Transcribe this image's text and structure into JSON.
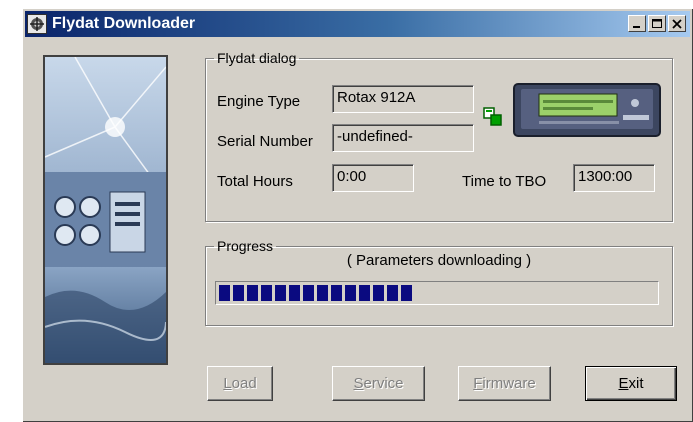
{
  "window": {
    "title": "Flydat Downloader",
    "icon": "flydat-app-icon",
    "controls": [
      "minimize-icon",
      "maximize-icon",
      "close-icon"
    ]
  },
  "side_image": {
    "description_icon": "cockpit-instruments-image"
  },
  "dialog": {
    "legend": "Flydat dialog",
    "engine_type_label": "Engine Type",
    "engine_type_value": "Rotax 912A",
    "serial_number_label": "Serial Number",
    "serial_number_value": "-undefined-",
    "total_hours_label": "Total Hours",
    "total_hours_value": "0:00",
    "time_to_tbo_label": "Time to TBO",
    "time_to_tbo_value": "1300:00",
    "link_icon": "connection-link-icon",
    "device_icon": "flydat-device-icon"
  },
  "progress": {
    "legend": "Progress",
    "status": "( Parameters downloading )",
    "fraction": 0.45
  },
  "buttons": {
    "load": {
      "access_key": "L",
      "rest": "oad",
      "enabled": false
    },
    "service": {
      "access_key": "S",
      "rest": "ervice",
      "enabled": false
    },
    "firmware": {
      "access_key": "F",
      "rest": "irmware",
      "enabled": false
    },
    "exit": {
      "access_key": "E",
      "rest": "xit",
      "enabled": true
    }
  },
  "colors": {
    "title_start": "#0a246a",
    "title_end": "#a6caf0",
    "progress_fill": "#0a0a80",
    "face": "#d4d0c8"
  }
}
